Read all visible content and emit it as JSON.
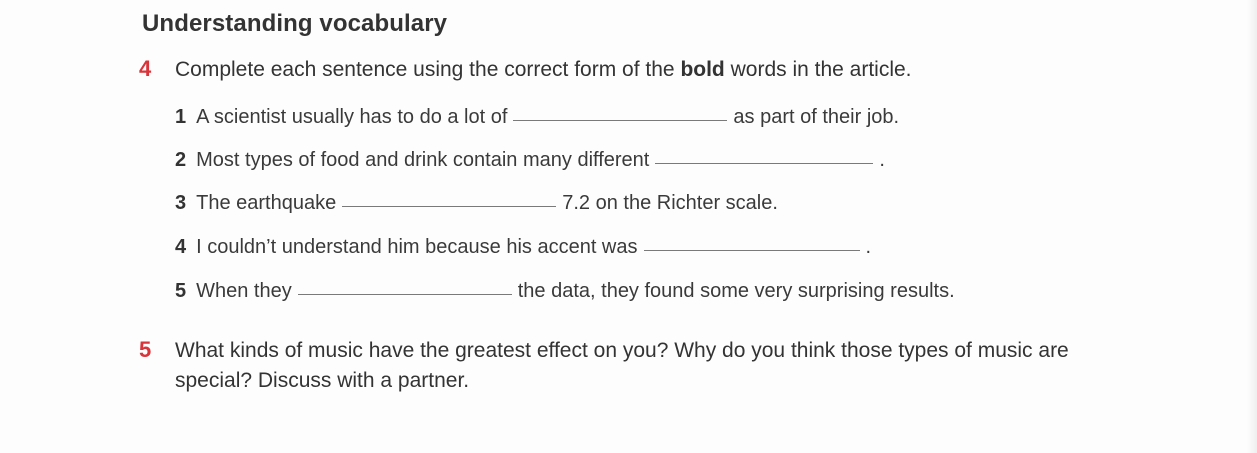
{
  "section": {
    "title": "Understanding vocabulary"
  },
  "q4": {
    "number": "4",
    "text_before": "Complete each sentence using the correct form of the ",
    "text_bold": "bold",
    "text_after": " words in the article.",
    "items": [
      {
        "num": "1",
        "before": "A scientist usually has to do a lot of",
        "after": "as part of their job."
      },
      {
        "num": "2",
        "before": "Most types of food and drink contain many different",
        "after": "."
      },
      {
        "num": "3",
        "before": "The earthquake",
        "after": "7.2 on the Richter scale."
      },
      {
        "num": "4",
        "before": "I couldn’t understand him because his accent was",
        "after": "."
      },
      {
        "num": "5",
        "before": "When they",
        "after": "the data, they found some very surprising results."
      }
    ]
  },
  "q5": {
    "number": "5",
    "line1": "What kinds of music have the greatest effect on you? Why do you think those types of music are",
    "line2": "special? Discuss with a partner."
  },
  "colors": {
    "accent": "#d8343a",
    "text": "#333333"
  }
}
